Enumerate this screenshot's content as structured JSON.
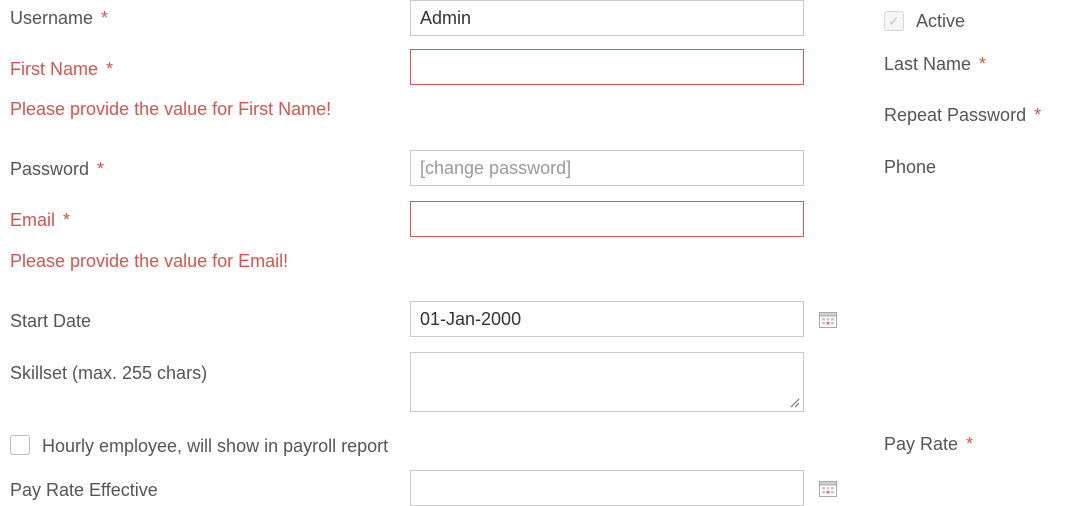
{
  "form": {
    "username": {
      "label": "Username",
      "required_mark": "*",
      "value": "Admin"
    },
    "first_name": {
      "label": "First Name",
      "required_mark": "*",
      "value": "",
      "error": "Please provide the value for First Name!"
    },
    "password": {
      "label": "Password",
      "required_mark": "*",
      "placeholder": "[change password]"
    },
    "email": {
      "label": "Email",
      "required_mark": "*",
      "value": "",
      "error": "Please provide the value for Email!"
    },
    "start_date": {
      "label": "Start Date",
      "value": "01-Jan-2000"
    },
    "skillset": {
      "label": "Skillset (max. 255 chars)",
      "value": ""
    },
    "hourly": {
      "label": "Hourly employee, will show in payroll report",
      "checked": false
    },
    "pay_rate_effective": {
      "label": "Pay Rate Effective",
      "value": ""
    }
  },
  "right_column": {
    "active": {
      "label": "Active",
      "checked": true,
      "disabled": true
    },
    "last_name": {
      "label": "Last Name",
      "required_mark": "*"
    },
    "repeat_password": {
      "label": "Repeat Password",
      "required_mark": "*"
    },
    "phone": {
      "label": "Phone"
    },
    "pay_rate": {
      "label": "Pay Rate",
      "required_mark": "*"
    }
  },
  "colors": {
    "error": "#d9534f",
    "label": "#555555",
    "border": "#c9c9c9",
    "placeholder": "#9a9a9a"
  },
  "icons": {
    "start_date_picker": "calendar-icon",
    "pay_rate_effective_picker": "calendar-icon",
    "active_check": "checkmark-icon",
    "resize_grip": "resize-grip-icon"
  }
}
